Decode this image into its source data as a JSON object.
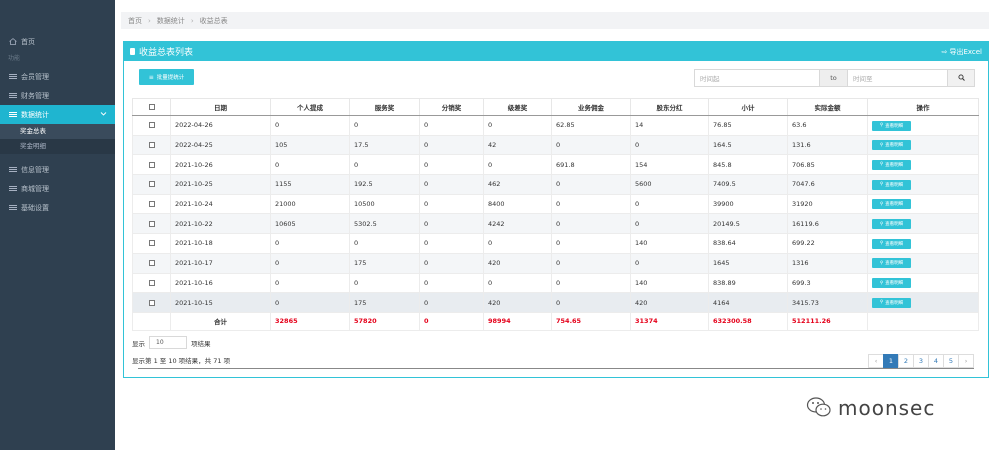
{
  "sidebar": {
    "home": "首页",
    "section": "功能",
    "items": [
      {
        "label": "会员管理",
        "icon": "list-icon"
      },
      {
        "label": "财务管理",
        "icon": "list-icon"
      },
      {
        "label": "数据统计",
        "icon": "list-icon",
        "active": true
      },
      {
        "label": "信息管理",
        "icon": "list-icon"
      },
      {
        "label": "商城管理",
        "icon": "list-icon"
      },
      {
        "label": "基础设置",
        "icon": "list-icon"
      }
    ],
    "subitems": [
      "奖金总表",
      "奖金明细"
    ]
  },
  "breadcrumb": [
    "首页",
    "数据统计",
    "收益总表"
  ],
  "panel": {
    "title": "收益总表列表",
    "export": "导出Excel",
    "batch_button": "批量提统计",
    "date_from_placeholder": "时间起",
    "date_to_label": "to",
    "date_till_placeholder": "时间至"
  },
  "table": {
    "columns": [
      "日期",
      "个人提成",
      "服务奖",
      "分销奖",
      "级差奖",
      "业务佣金",
      "股东分红",
      "小计",
      "实际金额",
      "操作"
    ],
    "detail_label": "查看明细",
    "rows": [
      [
        "2022-04-26",
        "0",
        "0",
        "0",
        "0",
        "62.85",
        "14",
        "76.85",
        "63.6"
      ],
      [
        "2022-04-25",
        "105",
        "17.5",
        "0",
        "42",
        "0",
        "0",
        "164.5",
        "131.6"
      ],
      [
        "2021-10-26",
        "0",
        "0",
        "0",
        "0",
        "691.8",
        "154",
        "845.8",
        "706.85"
      ],
      [
        "2021-10-25",
        "1155",
        "192.5",
        "0",
        "462",
        "0",
        "5600",
        "7409.5",
        "7047.6"
      ],
      [
        "2021-10-24",
        "21000",
        "10500",
        "0",
        "8400",
        "0",
        "0",
        "39900",
        "31920"
      ],
      [
        "2021-10-22",
        "10605",
        "5302.5",
        "0",
        "4242",
        "0",
        "0",
        "20149.5",
        "16119.6"
      ],
      [
        "2021-10-18",
        "0",
        "0",
        "0",
        "0",
        "0",
        "140",
        "838.64",
        "699.22"
      ],
      [
        "2021-10-17",
        "0",
        "175",
        "0",
        "420",
        "0",
        "0",
        "1645",
        "1316"
      ],
      [
        "2021-10-16",
        "0",
        "0",
        "0",
        "0",
        "0",
        "140",
        "838.89",
        "699.3"
      ],
      [
        "2021-10-15",
        "0",
        "175",
        "0",
        "420",
        "0",
        "420",
        "4164",
        "3415.73"
      ]
    ],
    "total": {
      "label": "合计",
      "values": [
        "32865",
        "57820",
        "0",
        "98994",
        "754.65",
        "31374",
        "632300.58",
        "512111.26"
      ]
    }
  },
  "footer": {
    "show_prefix": "显示",
    "page_size": "10",
    "show_suffix": "项结果",
    "info": "显示第 1 至 10 项结果，共 71 项",
    "pages": [
      "1",
      "2",
      "3",
      "4",
      "5"
    ],
    "prev": "‹",
    "next": "›"
  },
  "watermark": "moonsec"
}
